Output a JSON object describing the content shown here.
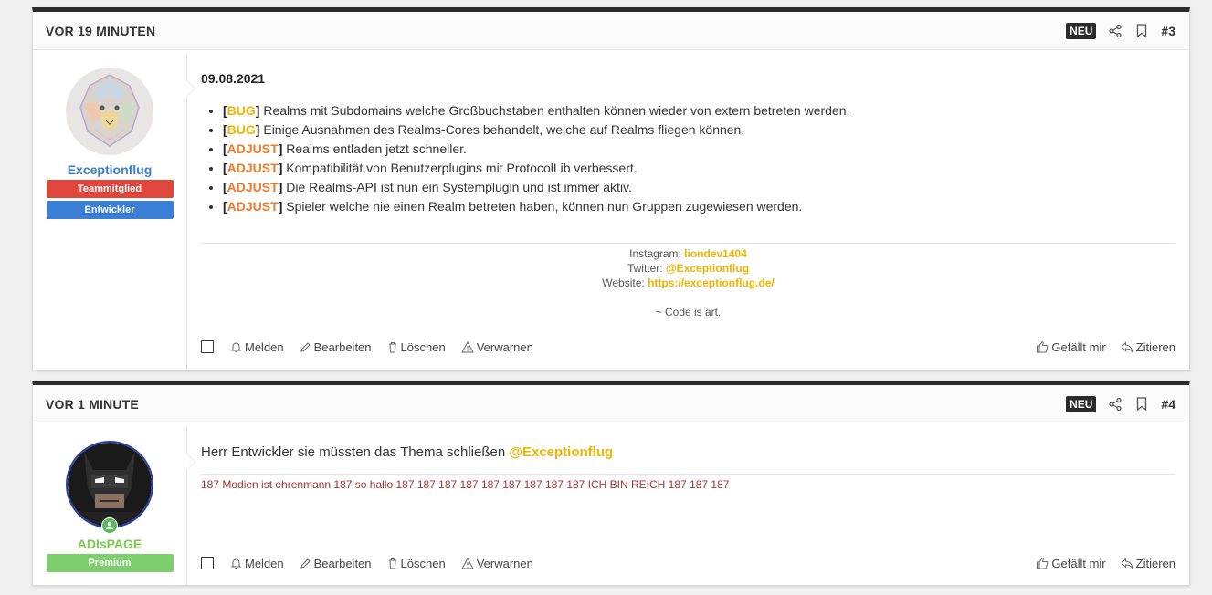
{
  "posts": [
    {
      "time": "VOR 19 MINUTEN",
      "badge": "NEU",
      "number": "#3",
      "user": {
        "name": "Exceptionflug",
        "name_color": "#3a7fd5",
        "roles": [
          {
            "label": "Teammitglied",
            "color": "#e0463b"
          },
          {
            "label": "Entwickler",
            "color": "#3a7fd5"
          }
        ]
      },
      "date": "09.08.2021",
      "changes": [
        {
          "tag": "BUG",
          "color": "#f0b400",
          "text": "Realms mit Subdomains welche Großbuchstaben enthalten können wieder von extern betreten werden."
        },
        {
          "tag": "BUG",
          "color": "#f0b400",
          "text": "Einige Ausnahmen des Realms-Cores behandelt, welche auf Realms fliegen können."
        },
        {
          "tag": "ADJUST",
          "color": "#f07a2b",
          "text": "Realms entladen jetzt schneller."
        },
        {
          "tag": "ADJUST",
          "color": "#f07a2b",
          "text": "Kompatibilität von Benutzerplugins mit ProtocolLib verbessert."
        },
        {
          "tag": "ADJUST",
          "color": "#f07a2b",
          "text": "Die Realms-API ist nun ein Systemplugin und ist immer aktiv."
        },
        {
          "tag": "ADJUST",
          "color": "#f07a2b",
          "text": "Spieler welche nie einen Realm betreten haben, können nun Gruppen zugewiesen werden."
        }
      ],
      "signature": {
        "instagram_label": "Instagram:",
        "instagram_value": "liondev1404",
        "twitter_label": "Twitter:",
        "twitter_value": "@Exceptionflug",
        "website_label": "Website:",
        "website_value": "https://exceptionflug.de/",
        "motto": "~ Code is art."
      }
    },
    {
      "time": "VOR 1 MINUTE",
      "badge": "NEU",
      "number": "#4",
      "user": {
        "name": "ADIsPAGE",
        "name_color": "#7dc94f",
        "roles": [
          {
            "label": "Premium",
            "color": "#7dcf6e"
          }
        ]
      },
      "message": "Herr Entwickler sie müssten das Thema schließen",
      "mention": "@Exceptionflug",
      "signature_text": "187 Modien ist ehrenmann 187 so hallo 187 187 187 187 187 187 187 187 187 ICH BIN REICH 187 187 187"
    }
  ],
  "actions": {
    "report": "Melden",
    "edit": "Bearbeiten",
    "delete": "Löschen",
    "warn": "Verwarnen",
    "like": "Gefällt mir",
    "quote": "Zitieren"
  }
}
